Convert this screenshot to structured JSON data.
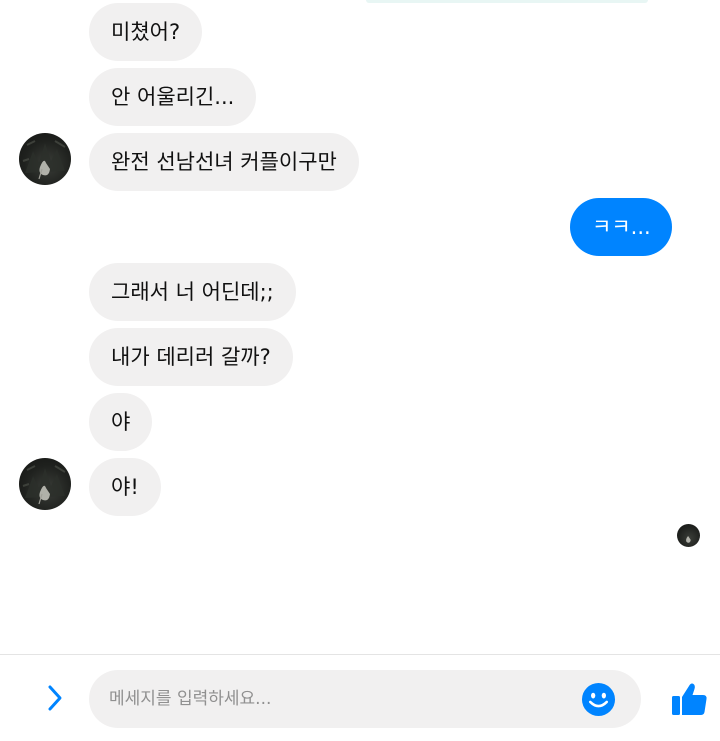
{
  "messages": [
    {
      "text": "미쳤어?",
      "from": "them"
    },
    {
      "text": "안 어울리긴...",
      "from": "them"
    },
    {
      "text": "완전 선남선녀 커플이구만",
      "from": "them"
    },
    {
      "text": "ㅋㅋ...",
      "from": "me"
    },
    {
      "text": "그래서 너 어딘데;;",
      "from": "them"
    },
    {
      "text": "내가 데리러 갈까?",
      "from": "them"
    },
    {
      "text": "야",
      "from": "them"
    },
    {
      "text": "야!",
      "from": "them"
    }
  ],
  "composer": {
    "placeholder": "메세지를 입력하세요..."
  },
  "icons": {
    "expand": "chevron-right-icon",
    "emoji": "smiley-icon",
    "like": "thumbs-up-icon"
  },
  "colors": {
    "accent": "#0084ff",
    "incoming_bubble": "#f1f0f0",
    "placeholder_text": "#909090"
  }
}
